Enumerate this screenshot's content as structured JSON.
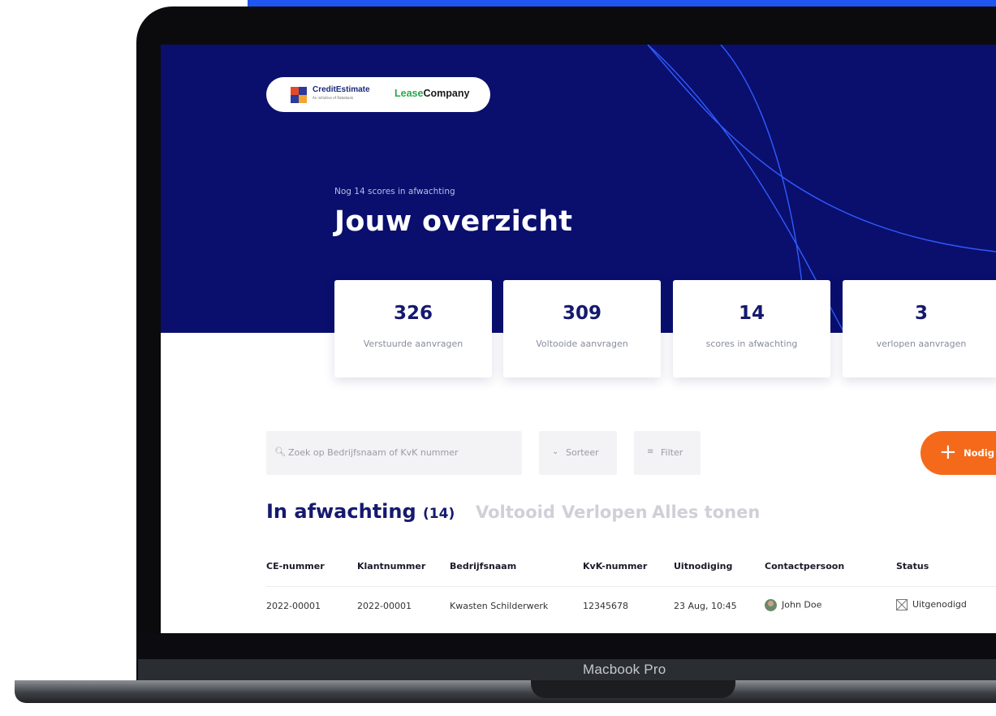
{
  "device": {
    "label": "Macbook Pro"
  },
  "header": {
    "logo_creditestimate": "CreditEstimate",
    "logo_creditestimate_sub": "An initiative of Rabobank",
    "logo_lease_prefix": "Lease",
    "logo_lease_suffix": "Company",
    "subtitle": "Nog 14 scores in afwachting",
    "title": "Jouw overzicht"
  },
  "stats": [
    {
      "value": "326",
      "label": "Verstuurde aanvragen"
    },
    {
      "value": "309",
      "label": "Voltooide aanvragen"
    },
    {
      "value": "14",
      "label": "scores in afwachting"
    },
    {
      "value": "3",
      "label": "verlopen aanvragen"
    }
  ],
  "toolbar": {
    "search_placeholder": "Zoek op Bedrijfsnaam of KvK nummer",
    "sort_label": "Sorteer",
    "filter_label": "Filter",
    "invite_label": "Nodig"
  },
  "tabs": [
    {
      "label": "In afwachting",
      "count": "(14)"
    },
    {
      "label": "Voltooid"
    },
    {
      "label": "Verlopen"
    },
    {
      "label": "Alles tonen"
    }
  ],
  "table": {
    "columns": [
      "CE-nummer",
      "Klantnummer",
      "Bedrijfsnaam",
      "KvK-nummer",
      "Uitnodiging",
      "Contactpersoon",
      "Status"
    ],
    "rows": [
      [
        "2022-00001",
        "2022-00001",
        "Kwasten Schilderwerk",
        "12345678",
        "23 Aug, 10:45",
        "John Doe",
        "Uitgenodigd"
      ]
    ]
  },
  "colors": {
    "hero": "#0a0f6e",
    "accent": "#f56a1a",
    "primary_text": "#15196e"
  },
  "icons": {
    "search": "search-icon",
    "sort": "chevron-down-icon",
    "filter": "filter-icon",
    "invite": "plus-icon",
    "status": "envelope-icon"
  }
}
